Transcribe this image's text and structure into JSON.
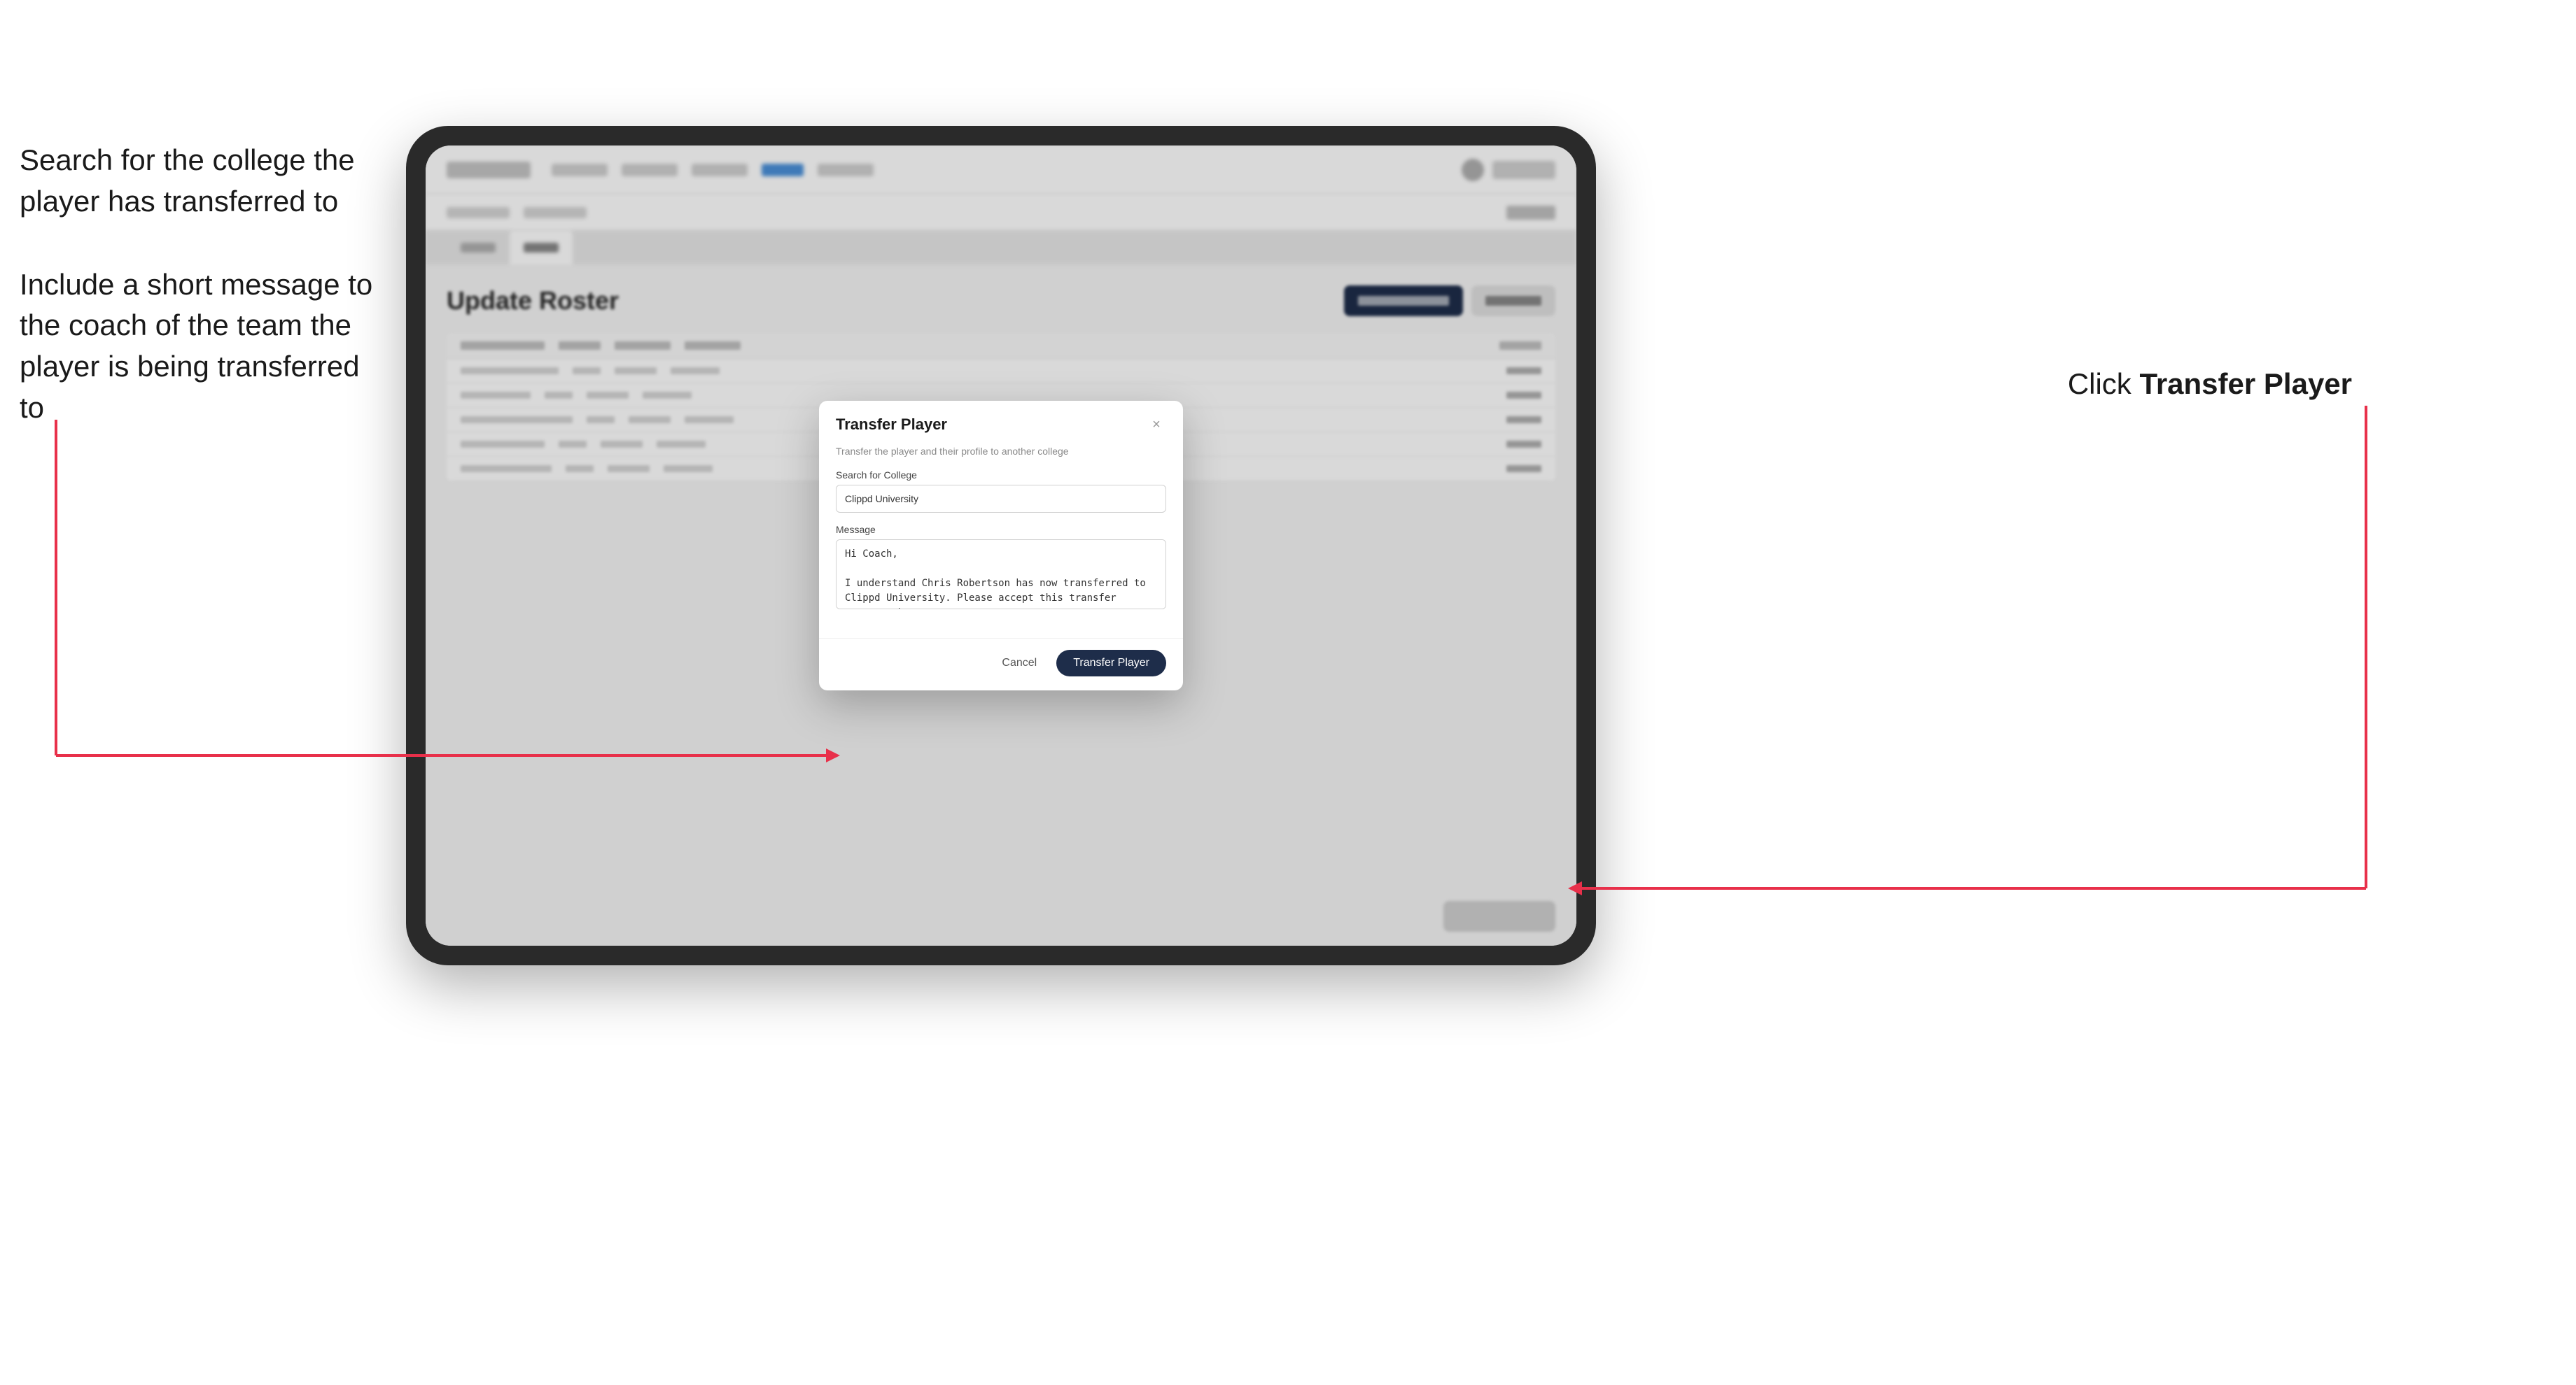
{
  "annotations": {
    "left_title1": "Search for the college the player has transferred to",
    "left_title2": "Include a short message to the coach of the team the player is being transferred to",
    "right_label": "Click",
    "right_label_bold": "Transfer Player"
  },
  "ipad": {
    "top_nav": {
      "logo_alt": "app-logo"
    },
    "main": {
      "page_title": "Update Roster"
    }
  },
  "modal": {
    "title": "Transfer Player",
    "subtitle": "Transfer the player and their profile to another college",
    "college_label": "Search for College",
    "college_value": "Clippd University",
    "message_label": "Message",
    "message_value": "Hi Coach,\n\nI understand Chris Robertson has now transferred to Clippd University. Please accept this transfer request when you can.",
    "cancel_label": "Cancel",
    "transfer_label": "Transfer Player"
  }
}
